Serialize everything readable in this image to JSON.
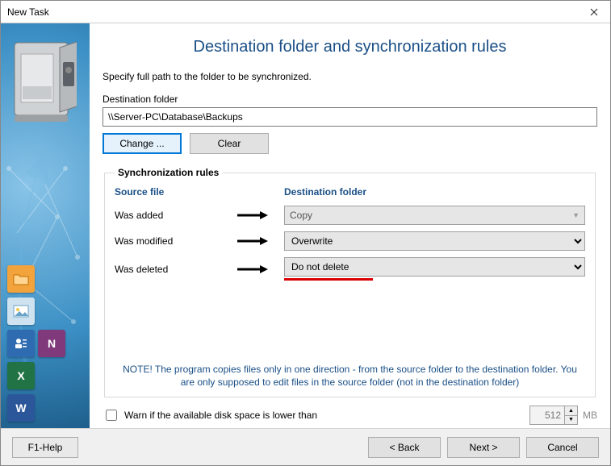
{
  "window": {
    "title": "New Task"
  },
  "page": {
    "heading": "Destination folder and synchronization rules",
    "instruction": "Specify full path to the folder to be synchronized."
  },
  "dest": {
    "label": "Destination folder",
    "path": "\\\\Server-PC\\Database\\Backups",
    "change_btn": "Change ...",
    "clear_btn": "Clear"
  },
  "rules": {
    "legend": "Synchronization rules",
    "source_header": "Source file",
    "dest_header": "Destination folder",
    "rows": [
      {
        "source": "Was added",
        "dest": "Copy",
        "enabled": false
      },
      {
        "source": "Was modified",
        "dest": "Overwrite",
        "enabled": true
      },
      {
        "source": "Was deleted",
        "dest": "Do not delete",
        "enabled": true
      }
    ],
    "note": "NOTE! The program copies files only in one direction - from the source folder to the destination folder. You are only supposed to edit files in the source folder (not in the destination folder)"
  },
  "warn": {
    "label": "Warn if the available disk space is lower than",
    "value": "512",
    "unit": "MB"
  },
  "footer": {
    "help": "F1-Help",
    "back": "< Back",
    "next": "Next >",
    "cancel": "Cancel"
  }
}
